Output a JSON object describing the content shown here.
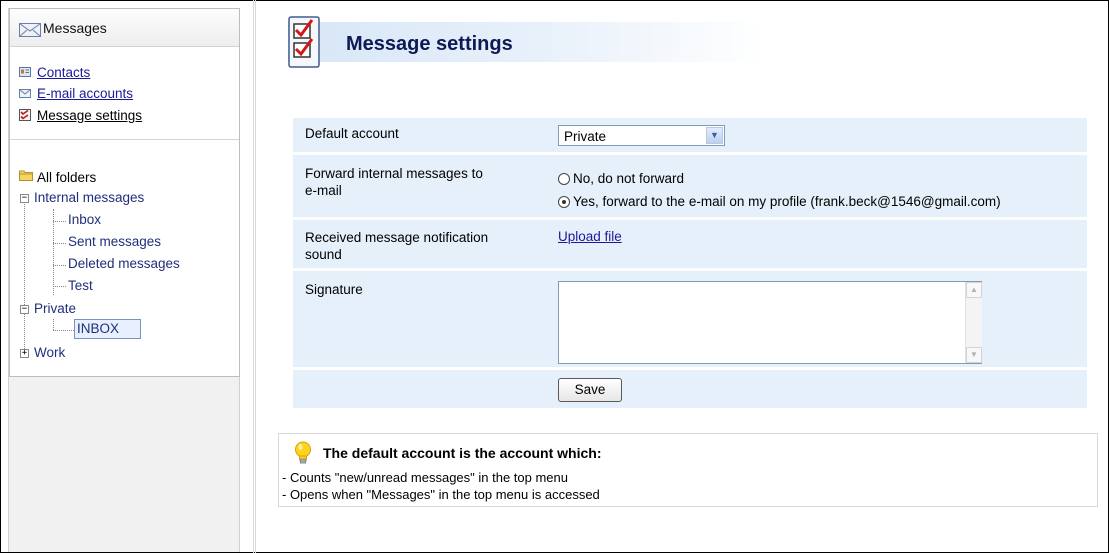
{
  "sidebar": {
    "title": "Messages",
    "nav": [
      {
        "label": "Contacts"
      },
      {
        "label": "E-mail accounts"
      },
      {
        "label": "Message settings"
      }
    ],
    "folders": {
      "root": "All folders",
      "internal": "Internal messages",
      "inbox": "Inbox",
      "sent": "Sent messages",
      "deleted": "Deleted messages",
      "test": "Test",
      "private": "Private",
      "private_inbox": "INBOX",
      "work": "Work"
    }
  },
  "main": {
    "title": "Message settings",
    "default_account": {
      "label": "Default account",
      "value": "Private"
    },
    "forward": {
      "label_line1": "Forward internal messages to",
      "label_line2": "e-mail",
      "option_no": "No, do not forward",
      "option_yes": "Yes, forward to the e-mail on my profile (frank.beck@1546@gmail.com)",
      "selected": "yes"
    },
    "sound": {
      "label_line1": "Received message notification",
      "label_line2": "sound",
      "upload_label": "Upload file"
    },
    "signature": {
      "label": "Signature",
      "value": ""
    },
    "save_label": "Save"
  },
  "info": {
    "title": "The default account is the account which:",
    "lines": [
      "- Counts \"new/unread messages\" in the top menu",
      "- Opens when \"Messages\" in the top menu is accessed"
    ]
  },
  "colors": {
    "row_bg": "#e6f0fa",
    "title_text": "#0d1a55",
    "link": "#1a1a9a"
  }
}
